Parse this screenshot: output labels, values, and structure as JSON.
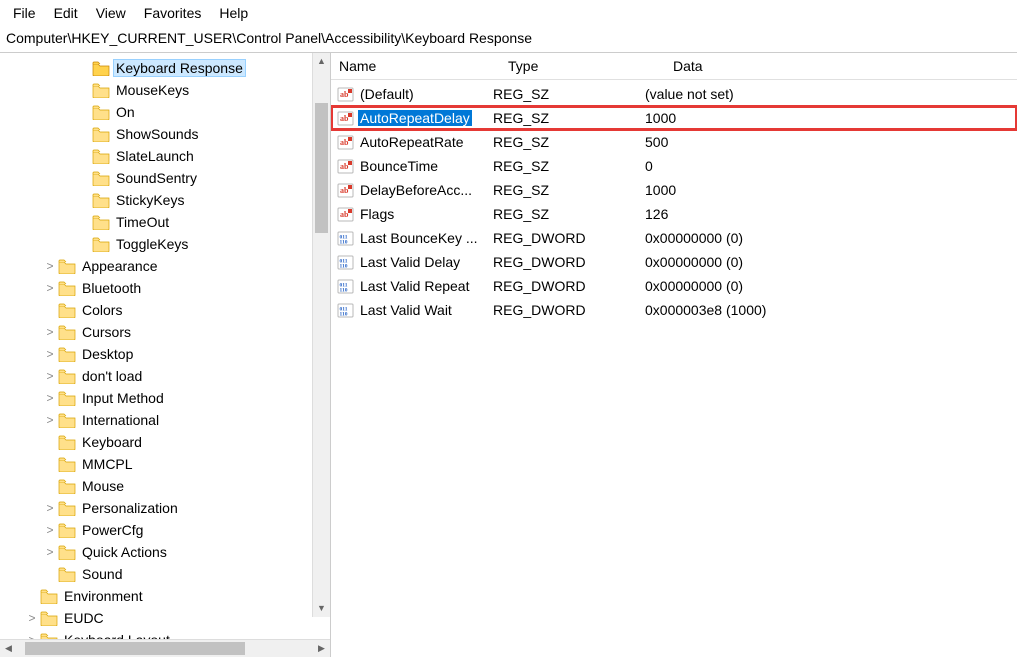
{
  "menu": {
    "file": "File",
    "edit": "Edit",
    "view": "View",
    "favorites": "Favorites",
    "help": "Help"
  },
  "address": "Computer\\HKEY_CURRENT_USER\\Control Panel\\Accessibility\\Keyboard Response",
  "tree": [
    {
      "ind": 92,
      "tw": "",
      "sel": true,
      "label": "Keyboard Response"
    },
    {
      "ind": 92,
      "tw": "",
      "label": "MouseKeys"
    },
    {
      "ind": 92,
      "tw": "",
      "label": "On"
    },
    {
      "ind": 92,
      "tw": "",
      "label": "ShowSounds"
    },
    {
      "ind": 92,
      "tw": "",
      "label": "SlateLaunch"
    },
    {
      "ind": 92,
      "tw": "",
      "label": "SoundSentry"
    },
    {
      "ind": 92,
      "tw": "",
      "label": "StickyKeys"
    },
    {
      "ind": 92,
      "tw": "",
      "label": "TimeOut"
    },
    {
      "ind": 92,
      "tw": "",
      "label": "ToggleKeys"
    },
    {
      "ind": 58,
      "tw": ">",
      "label": "Appearance"
    },
    {
      "ind": 58,
      "tw": ">",
      "label": "Bluetooth"
    },
    {
      "ind": 58,
      "tw": "",
      "label": "Colors"
    },
    {
      "ind": 58,
      "tw": ">",
      "label": "Cursors"
    },
    {
      "ind": 58,
      "tw": ">",
      "label": "Desktop"
    },
    {
      "ind": 58,
      "tw": ">",
      "label": "don't load"
    },
    {
      "ind": 58,
      "tw": ">",
      "label": "Input Method"
    },
    {
      "ind": 58,
      "tw": ">",
      "label": "International"
    },
    {
      "ind": 58,
      "tw": "",
      "label": "Keyboard"
    },
    {
      "ind": 58,
      "tw": "",
      "label": "MMCPL"
    },
    {
      "ind": 58,
      "tw": "",
      "label": "Mouse"
    },
    {
      "ind": 58,
      "tw": ">",
      "label": "Personalization"
    },
    {
      "ind": 58,
      "tw": ">",
      "label": "PowerCfg"
    },
    {
      "ind": 58,
      "tw": ">",
      "label": "Quick Actions"
    },
    {
      "ind": 58,
      "tw": "",
      "label": "Sound"
    },
    {
      "ind": 40,
      "tw": "",
      "label": "Environment"
    },
    {
      "ind": 40,
      "tw": ">",
      "label": "EUDC"
    },
    {
      "ind": 40,
      "tw": ">",
      "label": "Keyboard Layout"
    }
  ],
  "columns": {
    "name": "Name",
    "type": "Type",
    "data": "Data"
  },
  "values": [
    {
      "icon": "sz",
      "name": "(Default)",
      "type": "REG_SZ",
      "data": "(value not set)"
    },
    {
      "icon": "sz",
      "name": "AutoRepeatDelay",
      "type": "REG_SZ",
      "data": "1000",
      "hl": true
    },
    {
      "icon": "sz",
      "name": "AutoRepeatRate",
      "type": "REG_SZ",
      "data": "500"
    },
    {
      "icon": "sz",
      "name": "BounceTime",
      "type": "REG_SZ",
      "data": "0"
    },
    {
      "icon": "sz",
      "name": "DelayBeforeAcc...",
      "type": "REG_SZ",
      "data": "1000"
    },
    {
      "icon": "sz",
      "name": "Flags",
      "type": "REG_SZ",
      "data": "126"
    },
    {
      "icon": "dw",
      "name": "Last BounceKey ...",
      "type": "REG_DWORD",
      "data": "0x00000000 (0)"
    },
    {
      "icon": "dw",
      "name": "Last Valid Delay",
      "type": "REG_DWORD",
      "data": "0x00000000 (0)"
    },
    {
      "icon": "dw",
      "name": "Last Valid Repeat",
      "type": "REG_DWORD",
      "data": "0x00000000 (0)"
    },
    {
      "icon": "dw",
      "name": "Last Valid Wait",
      "type": "REG_DWORD",
      "data": "0x000003e8 (1000)"
    }
  ]
}
